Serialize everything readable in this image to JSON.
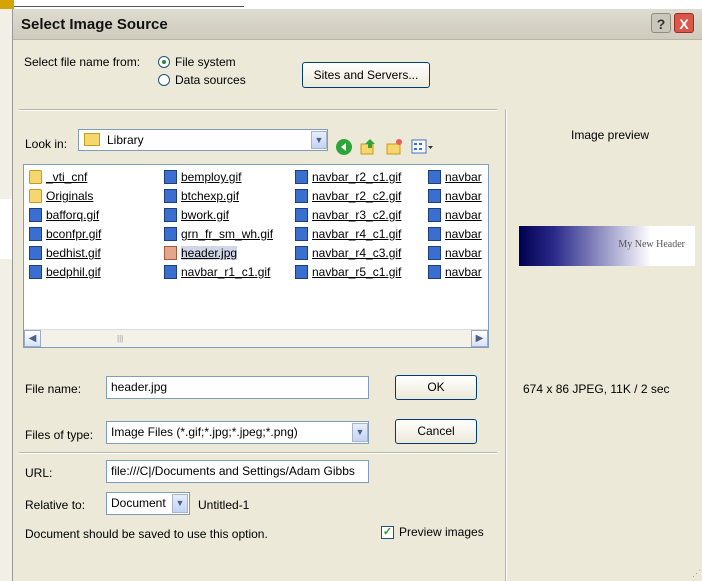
{
  "dialog": {
    "title": "Select Image Source",
    "help_label": "?",
    "close_label": "X"
  },
  "source": {
    "label": "Select file name from:",
    "options": [
      "File system",
      "Data sources"
    ],
    "selected": "File system",
    "sites_button": "Sites and Servers..."
  },
  "lookin": {
    "label": "Look in:",
    "folder": "Library"
  },
  "files": {
    "columns": [
      [
        {
          "name": "_vti_cnf",
          "icon": "folder-icon"
        },
        {
          "name": "Originals",
          "icon": "folder-icon"
        },
        {
          "name": "bafforq.gif",
          "icon": "gif-file-icon"
        },
        {
          "name": "bconfpr.gif",
          "icon": "gif-file-icon"
        },
        {
          "name": "bedhist.gif",
          "icon": "gif-file-icon"
        },
        {
          "name": "bedphil.gif",
          "icon": "gif-file-icon"
        }
      ],
      [
        {
          "name": "bemploy.gif",
          "icon": "gif-file-icon"
        },
        {
          "name": "btchexp.gif",
          "icon": "gif-file-icon"
        },
        {
          "name": "bwork.gif",
          "icon": "gif-file-icon"
        },
        {
          "name": "grn_fr_sm_wh.gif",
          "icon": "gif-file-icon"
        },
        {
          "name": "header.jpg",
          "icon": "jpg-file-icon",
          "selected": true
        },
        {
          "name": "navbar_r1_c1.gif",
          "icon": "gif-file-icon"
        }
      ],
      [
        {
          "name": "navbar_r2_c1.gif",
          "icon": "gif-file-icon"
        },
        {
          "name": "navbar_r2_c2.gif",
          "icon": "gif-file-icon"
        },
        {
          "name": "navbar_r3_c2.gif",
          "icon": "gif-file-icon"
        },
        {
          "name": "navbar_r4_c1.gif",
          "icon": "gif-file-icon"
        },
        {
          "name": "navbar_r4_c3.gif",
          "icon": "gif-file-icon"
        },
        {
          "name": "navbar_r5_c1.gif",
          "icon": "gif-file-icon"
        }
      ],
      [
        {
          "name": "navbar",
          "icon": "gif-file-icon"
        },
        {
          "name": "navbar",
          "icon": "gif-file-icon"
        },
        {
          "name": "navbar",
          "icon": "gif-file-icon"
        },
        {
          "name": "navbar",
          "icon": "gif-file-icon"
        },
        {
          "name": "navbar",
          "icon": "gif-file-icon"
        },
        {
          "name": "navbar",
          "icon": "gif-file-icon"
        }
      ]
    ]
  },
  "filename": {
    "label": "File name:",
    "value": "header.jpg",
    "ok_button": "OK"
  },
  "filetype": {
    "label": "Files of type:",
    "value": "Image Files (*.gif;*.jpg;*.jpeg;*.png)",
    "cancel_button": "Cancel"
  },
  "url": {
    "label": "URL:",
    "value": "file:///C|/Documents and Settings/Adam Gibbs"
  },
  "relative": {
    "label": "Relative to:",
    "value": "Document",
    "doc_name": "Untitled-1"
  },
  "note": "Document should be saved to use this option.",
  "preview_checkbox": {
    "label": "Preview images",
    "checked": true
  },
  "preview": {
    "heading": "Image preview",
    "image_text": "My New Header",
    "info": "674 x 86 JPEG, 11K / 2 sec"
  },
  "colors": {
    "dialog_bg": "#ece9d8",
    "close_button": "#d9564a",
    "field_border": "#7f9db9",
    "header_gradient_dark": "#000050"
  }
}
